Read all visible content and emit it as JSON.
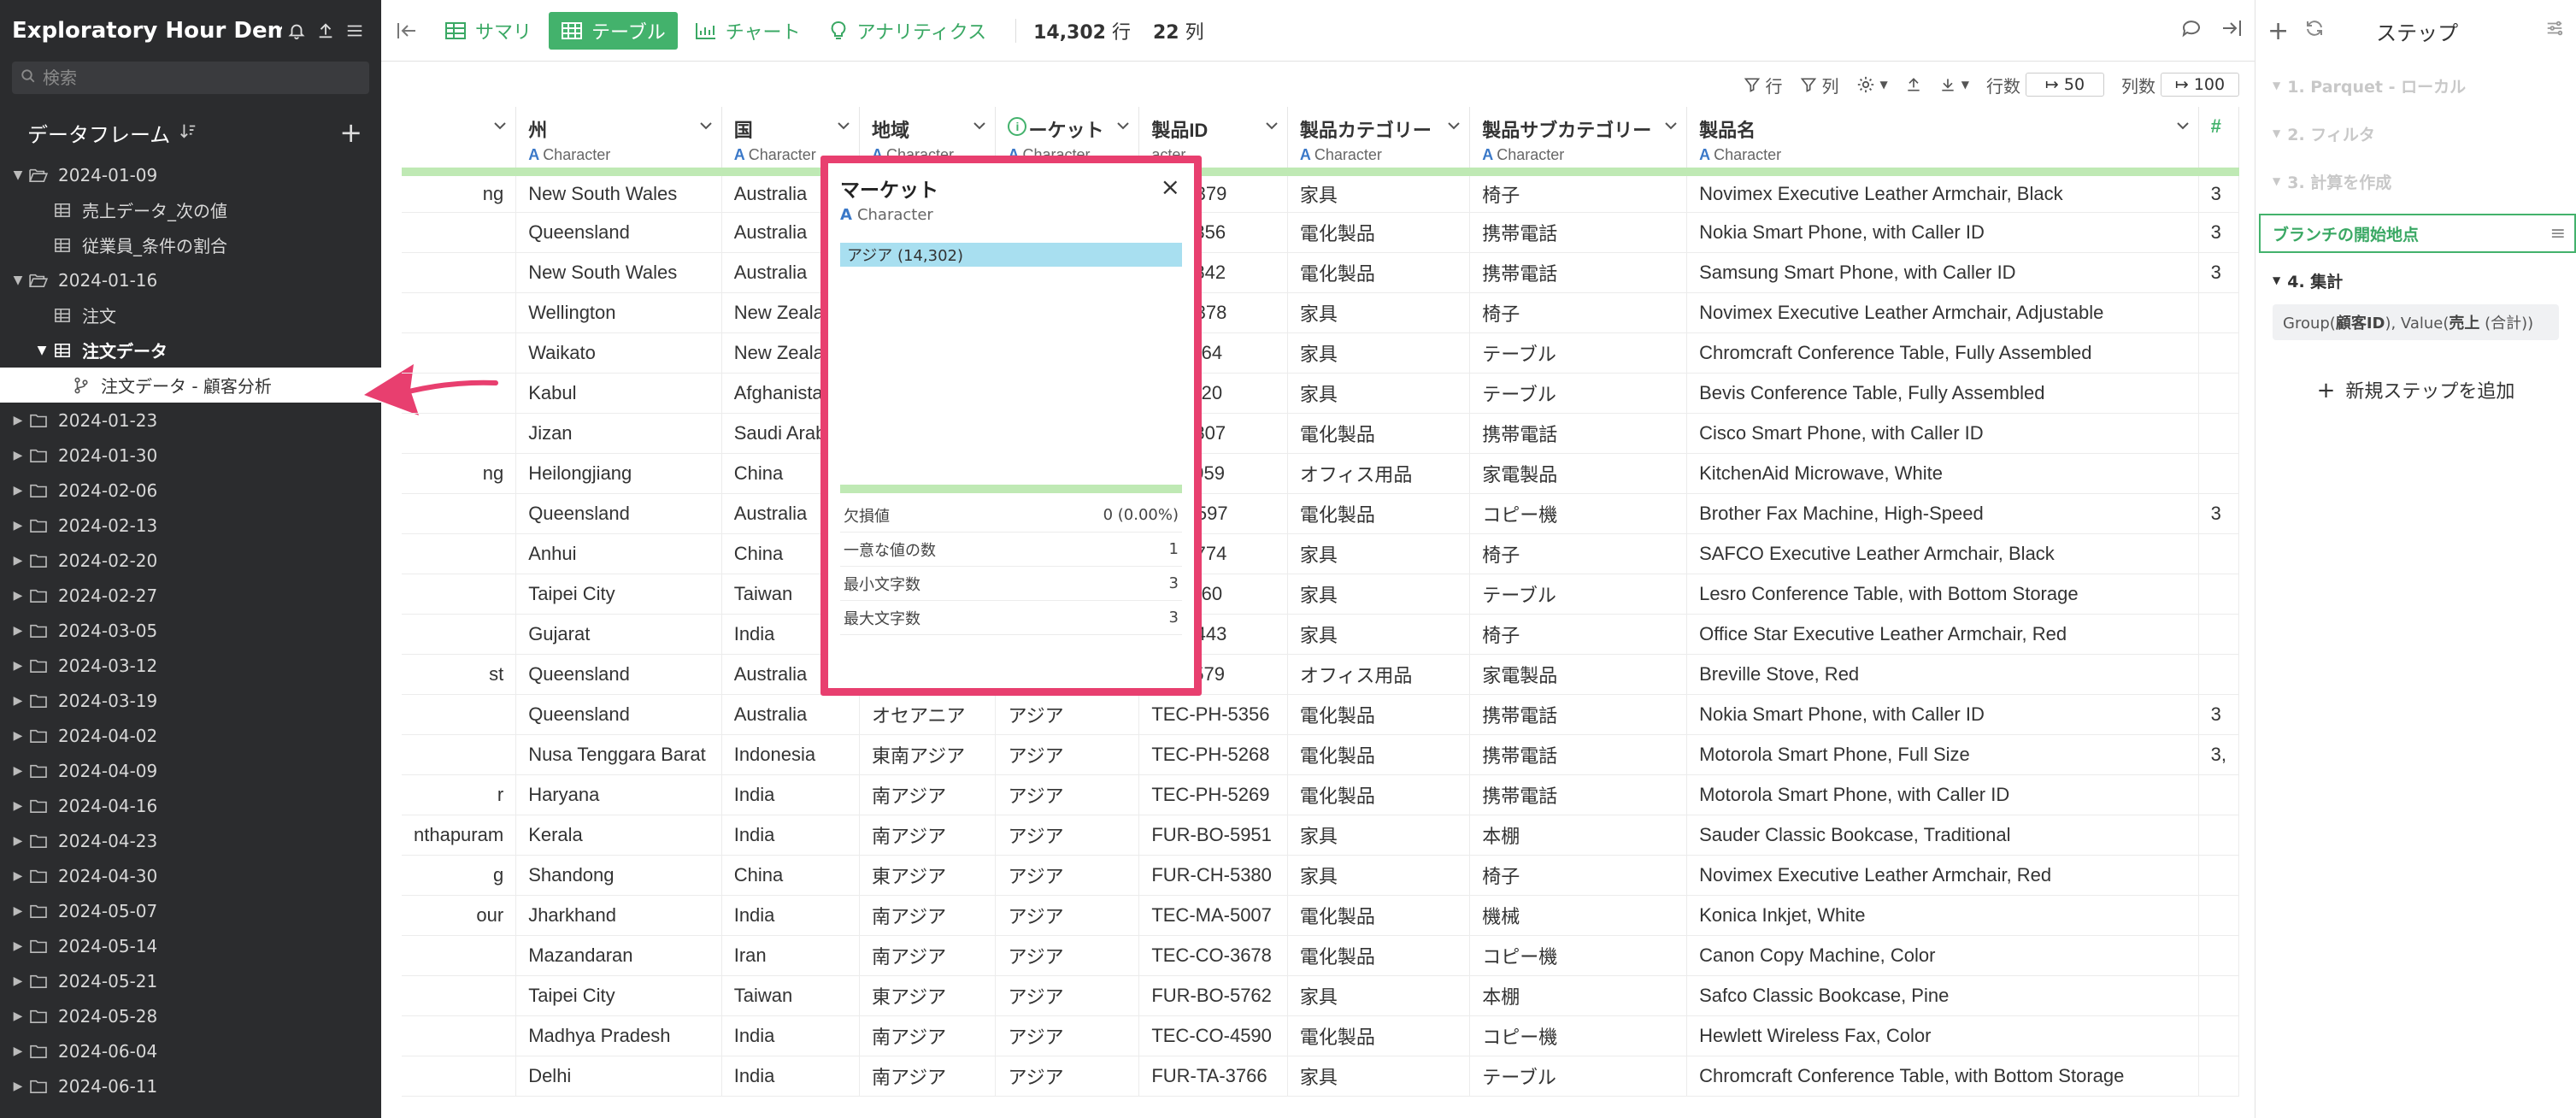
{
  "sidebar": {
    "title": "Exploratory Hour Dem...",
    "search_placeholder": "検索",
    "dataframes_label": "データフレーム",
    "tree": [
      {
        "type": "folder-open",
        "label": "2024-01-09",
        "indent": 0
      },
      {
        "type": "table",
        "label": "売上データ_次の値",
        "indent": 1
      },
      {
        "type": "table",
        "label": "従業員_条件の割合",
        "indent": 1
      },
      {
        "type": "folder-open",
        "label": "2024-01-16",
        "indent": 0
      },
      {
        "type": "table",
        "label": "注文",
        "indent": 1
      },
      {
        "type": "table-open",
        "label": "注文データ",
        "indent": 1,
        "bold": true
      },
      {
        "type": "branch",
        "label": "注文データ - 顧客分析",
        "indent": 2,
        "selected": true
      },
      {
        "type": "folder",
        "label": "2024-01-23",
        "indent": 0
      },
      {
        "type": "folder",
        "label": "2024-01-30",
        "indent": 0
      },
      {
        "type": "folder",
        "label": "2024-02-06",
        "indent": 0
      },
      {
        "type": "folder",
        "label": "2024-02-13",
        "indent": 0
      },
      {
        "type": "folder",
        "label": "2024-02-20",
        "indent": 0
      },
      {
        "type": "folder",
        "label": "2024-02-27",
        "indent": 0
      },
      {
        "type": "folder",
        "label": "2024-03-05",
        "indent": 0
      },
      {
        "type": "folder",
        "label": "2024-03-12",
        "indent": 0
      },
      {
        "type": "folder",
        "label": "2024-03-19",
        "indent": 0
      },
      {
        "type": "folder",
        "label": "2024-04-02",
        "indent": 0
      },
      {
        "type": "folder",
        "label": "2024-04-09",
        "indent": 0
      },
      {
        "type": "folder",
        "label": "2024-04-16",
        "indent": 0
      },
      {
        "type": "folder",
        "label": "2024-04-23",
        "indent": 0
      },
      {
        "type": "folder",
        "label": "2024-04-30",
        "indent": 0
      },
      {
        "type": "folder",
        "label": "2024-05-07",
        "indent": 0
      },
      {
        "type": "folder",
        "label": "2024-05-14",
        "indent": 0
      },
      {
        "type": "folder",
        "label": "2024-05-21",
        "indent": 0
      },
      {
        "type": "folder",
        "label": "2024-05-28",
        "indent": 0
      },
      {
        "type": "folder",
        "label": "2024-06-04",
        "indent": 0
      },
      {
        "type": "folder",
        "label": "2024-06-11",
        "indent": 0
      }
    ]
  },
  "toolbar": {
    "tabs": [
      {
        "label": "サマリ",
        "icon": "summary-grid-icon",
        "active": false
      },
      {
        "label": "テーブル",
        "icon": "table-icon",
        "active": true
      },
      {
        "label": "チャート",
        "icon": "chart-icon",
        "active": false
      },
      {
        "label": "アナリティクス",
        "icon": "analytics-bulb-icon",
        "active": false
      }
    ],
    "row_count": "14,302",
    "row_unit": "行",
    "col_count": "22",
    "col_unit": "列"
  },
  "toolbar2": {
    "row_filter": "行",
    "col_filter": "列",
    "rows_label": "行数",
    "rows_value": "50",
    "cols_label": "列数",
    "cols_value": "100"
  },
  "table": {
    "columns": [
      {
        "name": "",
        "type": ""
      },
      {
        "name": "州",
        "type": "Character"
      },
      {
        "name": "国",
        "type": "Character"
      },
      {
        "name": "地域",
        "type": "Character"
      },
      {
        "name": "ーケット",
        "type": "Character"
      },
      {
        "name": "製品ID",
        "type": "acter"
      },
      {
        "name": "製品カテゴリー",
        "type": "Character"
      },
      {
        "name": "製品サブカテゴリー",
        "type": "Character"
      },
      {
        "name": "製品名",
        "type": "Character"
      },
      {
        "name": "#",
        "type": ""
      }
    ],
    "rows": [
      [
        "ng",
        "New South Wales",
        "Australia",
        "",
        "",
        "CH-5379",
        "家具",
        "椅子",
        "Novimex Executive Leather Armchair, Black",
        "3"
      ],
      [
        "",
        "Queensland",
        "Australia",
        "",
        "",
        "PH-5356",
        "電化製品",
        "携帯電話",
        "Nokia Smart Phone, with Caller ID",
        "3"
      ],
      [
        "",
        "New South Wales",
        "Australia",
        "",
        "",
        "PH-5842",
        "電化製品",
        "携帯電話",
        "Samsung Smart Phone, with Caller ID",
        "3"
      ],
      [
        "",
        "Wellington",
        "New Zealan",
        "",
        "",
        "CH-5378",
        "家具",
        "椅子",
        "Novimex Executive Leather Armchair, Adjustable",
        ""
      ],
      [
        "",
        "Waikato",
        "New Zealan",
        "",
        "",
        "TA-3764",
        "家具",
        "テーブル",
        "Chromcraft Conference Table, Fully Assembled",
        ""
      ],
      [
        "",
        "Kabul",
        "Afghanistar",
        "",
        "",
        "TA-3420",
        "家具",
        "テーブル",
        "Bevis Conference Table, Fully Assembled",
        ""
      ],
      [
        "",
        "Jizan",
        "Saudi Arabi",
        "",
        "",
        "PH-3807",
        "電化製品",
        "携帯電話",
        "Cisco Smart Phone, with Caller ID",
        ""
      ],
      [
        "ng",
        "Heilongjiang",
        "China",
        "",
        "",
        "AP-4959",
        "オフィス用品",
        "家電製品",
        "KitchenAid Microwave, White",
        ""
      ],
      [
        "",
        "Queensland",
        "Australia",
        "",
        "",
        "CO-3597",
        "電化製品",
        "コピー機",
        "Brother Fax Machine, High-Speed",
        "3"
      ],
      [
        "",
        "Anhui",
        "China",
        "",
        "",
        "CH-5774",
        "家具",
        "椅子",
        "SAFCO Executive Leather Armchair, Black",
        ""
      ],
      [
        "",
        "Taipei City",
        "Taiwan",
        "",
        "",
        "TA-5060",
        "家具",
        "テーブル",
        "Lesro Conference Table, with Bottom Storage",
        ""
      ],
      [
        "",
        "Gujarat",
        "India",
        "",
        "",
        "CH-5443",
        "家具",
        "椅子",
        "Office Star Executive Leather Armchair, Red",
        ""
      ],
      [
        "st",
        "Queensland",
        "Australia",
        "",
        "",
        "AP-3579",
        "オフィス用品",
        "家電製品",
        "Breville Stove, Red",
        ""
      ],
      [
        "",
        "Queensland",
        "Australia",
        "オセアニア",
        "アジア",
        "TEC-PH-5356",
        "電化製品",
        "携帯電話",
        "Nokia Smart Phone, with Caller ID",
        "3"
      ],
      [
        "",
        "Nusa Tenggara Barat",
        "Indonesia",
        "東南アジア",
        "アジア",
        "TEC-PH-5268",
        "電化製品",
        "携帯電話",
        "Motorola Smart Phone, Full Size",
        "3,"
      ],
      [
        "r",
        "Haryana",
        "India",
        "南アジア",
        "アジア",
        "TEC-PH-5269",
        "電化製品",
        "携帯電話",
        "Motorola Smart Phone, with Caller ID",
        ""
      ],
      [
        "nthapuram",
        "Kerala",
        "India",
        "南アジア",
        "アジア",
        "FUR-BO-5951",
        "家具",
        "本棚",
        "Sauder Classic Bookcase, Traditional",
        ""
      ],
      [
        "g",
        "Shandong",
        "China",
        "東アジア",
        "アジア",
        "FUR-CH-5380",
        "家具",
        "椅子",
        "Novimex Executive Leather Armchair, Red",
        ""
      ],
      [
        "our",
        "Jharkhand",
        "India",
        "南アジア",
        "アジア",
        "TEC-MA-5007",
        "電化製品",
        "機械",
        "Konica Inkjet, White",
        ""
      ],
      [
        "",
        "Mazandaran",
        "Iran",
        "南アジア",
        "アジア",
        "TEC-CO-3678",
        "電化製品",
        "コピー機",
        "Canon Copy Machine, Color",
        ""
      ],
      [
        "",
        "Taipei City",
        "Taiwan",
        "東アジア",
        "アジア",
        "FUR-BO-5762",
        "家具",
        "本棚",
        "Safco Classic Bookcase, Pine",
        ""
      ],
      [
        "",
        "Madhya Pradesh",
        "India",
        "南アジア",
        "アジア",
        "TEC-CO-4590",
        "電化製品",
        "コピー機",
        "Hewlett Wireless Fax, Color",
        ""
      ],
      [
        "",
        "Delhi",
        "India",
        "南アジア",
        "アジア",
        "FUR-TA-3766",
        "家具",
        "テーブル",
        "Chromcraft Conference Table, with Bottom Storage",
        ""
      ]
    ]
  },
  "popup": {
    "title": "マーケット",
    "type": "Character",
    "bar_label": "アジア (14,302)",
    "bar_fraction": 1.0,
    "stats": [
      {
        "label": "欠損値",
        "value": "0 (0.00%)"
      },
      {
        "label": "一意な値の数",
        "value": "1"
      },
      {
        "label": "最小文字数",
        "value": "3"
      },
      {
        "label": "最大文字数",
        "value": "3"
      }
    ]
  },
  "right_panel": {
    "title": "ステップ",
    "steps": [
      "1. Parquet - ローカル",
      "2. フィルタ",
      "3. 計算を作成"
    ],
    "branch_label": "ブランチの開始地点",
    "agg_step": "4. 集計",
    "agg_chip_group_label": "Group(",
    "agg_chip_group_field": "顧客ID",
    "agg_chip_value_label": "), Value(",
    "agg_chip_value_field": "売上",
    "agg_chip_value_suffix": " (合計))",
    "add_step_label": "新規ステップを追加"
  },
  "colors": {
    "sidebar_bg": "#2b2c2e",
    "accent_green": "#43b26c",
    "highlight_pink": "#e83f6f",
    "popup_bar": "#a8dff0",
    "header_green": "#bfe9b4"
  }
}
